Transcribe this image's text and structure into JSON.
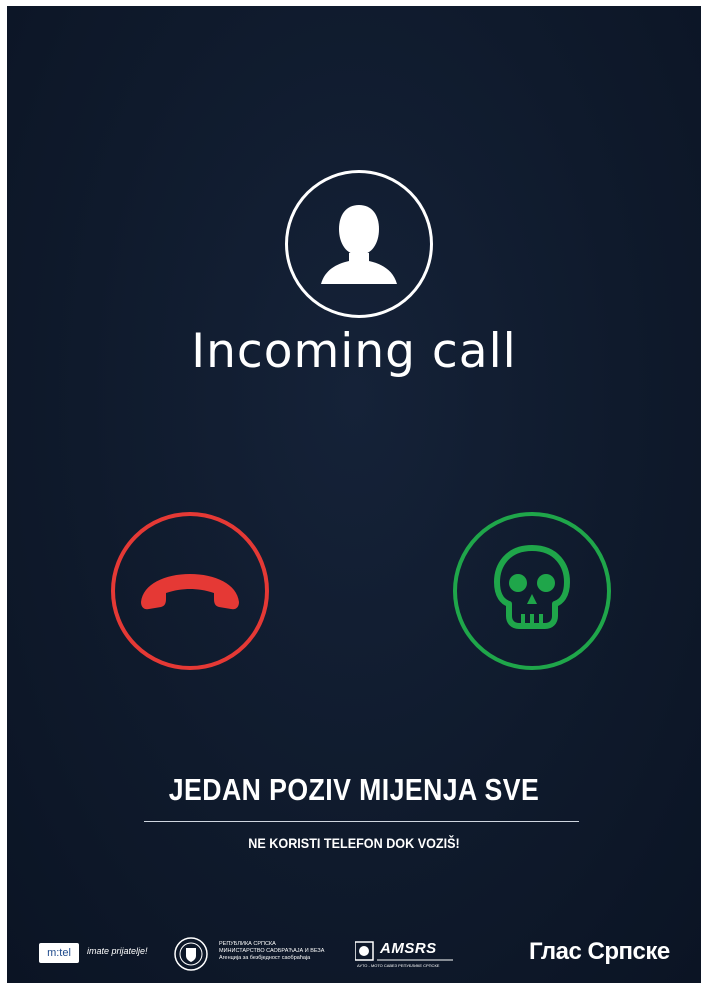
{
  "headline": {
    "caller_title": "Incoming call"
  },
  "icons": {
    "caller": "user-avatar-icon",
    "decline": "phone-hangup-icon",
    "accept": "skull-icon"
  },
  "colors": {
    "background": "#0f1a2c",
    "decline": "#e53935",
    "accept": "#1fa64a",
    "text": "#ffffff"
  },
  "campaign": {
    "slogan": "JEDAN POZIV MIJENJA SVE",
    "subslogan": "NE KORISTI TELEFON DOK VOZIŠ!"
  },
  "footer": {
    "mtel_logo": "m:tel",
    "mtel_tagline": "imate prijatelje!",
    "ministry_line1": "РЕПУБЛИКА СРПСКА",
    "ministry_line2": "МИНИСТАРСТВО САОБРАЋАЈА И ВЕЗА",
    "ministry_line3": "Агенција за безбједност саобраћаја",
    "amsrs_logo": "AMSRS",
    "amsrs_sub": "АУТО - МОТО САВЕЗ РЕПУБЛИКЕ СРПСКЕ",
    "newspaper_logo": "Глас Српске"
  }
}
